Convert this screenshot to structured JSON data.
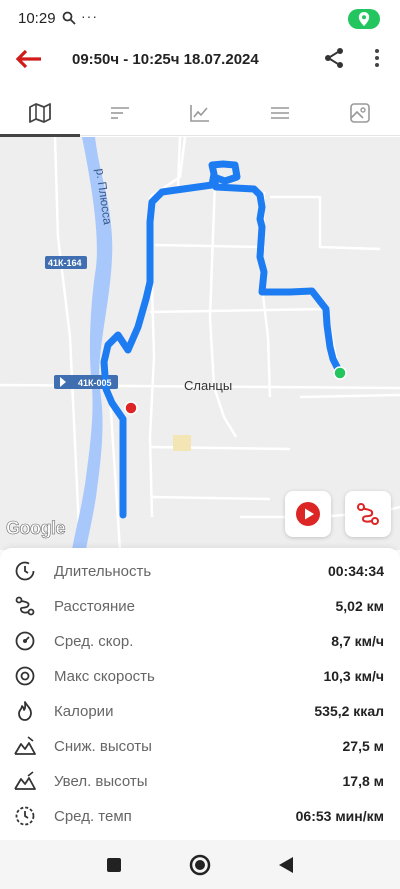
{
  "status_bar": {
    "time": "10:29",
    "dots": "···",
    "accent": "#22c55e"
  },
  "header": {
    "title": "09:50ч - 10:25ч   18.07.2024"
  },
  "tabs": [
    {
      "name": "map-icon",
      "active": true
    },
    {
      "name": "sort-icon",
      "active": false
    },
    {
      "name": "chart-icon",
      "active": false
    },
    {
      "name": "list-icon",
      "active": false
    },
    {
      "name": "photo-icon",
      "active": false
    }
  ],
  "map": {
    "river_label": "р. Плюсса",
    "road_label_1": "41К-164",
    "road_label_2": "41К-005",
    "town_label": "Сланцы",
    "google": "Google",
    "route_color": "#1e7cf2",
    "start_color": "#22c55e",
    "end_color": "#dc2626"
  },
  "stats": [
    {
      "label": "Длительность",
      "value": "00:34:34",
      "icon": "timer-icon"
    },
    {
      "label": "Расстояние",
      "value": "5,02 км",
      "icon": "route-icon"
    },
    {
      "label": "Сред. скор.",
      "value": "8,7 км/ч",
      "icon": "speedometer-icon"
    },
    {
      "label": "Макс скорость",
      "value": "10,3 км/ч",
      "icon": "max-speed-icon"
    },
    {
      "label": "Калории",
      "value": "535,2 ккал",
      "icon": "calories-icon"
    },
    {
      "label": "Сниж. высоты",
      "value": "27,5 м",
      "icon": "descent-icon"
    },
    {
      "label": "Увел. высоты",
      "value": "17,8 м",
      "icon": "ascent-icon"
    },
    {
      "label": "Сред. темп",
      "value": "06:53 мин/км",
      "icon": "pace-icon"
    }
  ]
}
